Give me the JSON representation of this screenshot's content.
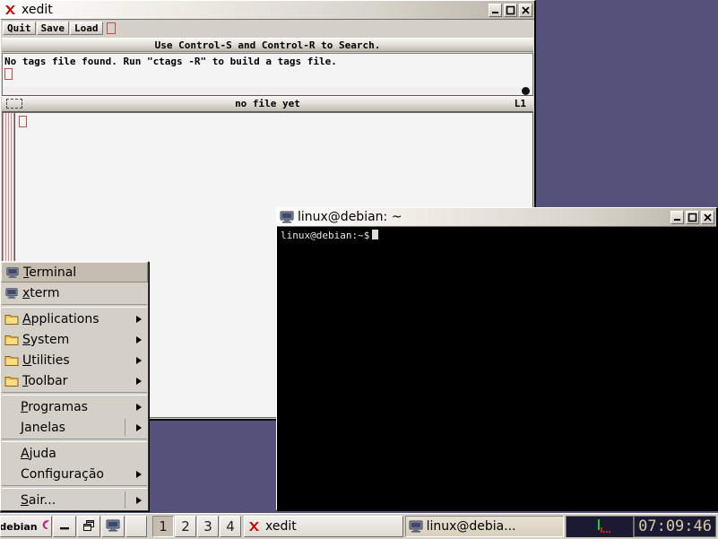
{
  "desktop": {
    "background_color": "#54527a"
  },
  "xedit": {
    "title": "xedit",
    "icon": "x-logo-icon",
    "buttons": {
      "quit": "Quit",
      "save": "Save",
      "load": "Load"
    },
    "message_bar": "Use Control-S and Control-R to Search.",
    "message_text": "No tags file found.  Run \"ctags -R\" to build a tags file.",
    "status_filename": "no file yet",
    "status_line": "L1",
    "window_controls": {
      "minimize": "minimize",
      "maximize": "maximize",
      "close": "close"
    }
  },
  "terminal": {
    "title": "linux@debian: ~",
    "icon": "computer-monitor-icon",
    "prompt": "linux@debian:~$",
    "window_controls": {
      "minimize": "minimize",
      "maximize": "maximize",
      "close": "close"
    }
  },
  "root_menu": {
    "items": [
      {
        "label": "Terminal",
        "mnemonic": "T",
        "icon": "computer-monitor-icon",
        "submenu": false,
        "selected": true,
        "indent": false
      },
      {
        "label": "xterm",
        "mnemonic": "x",
        "icon": "computer-monitor-icon",
        "submenu": false,
        "selected": false,
        "indent": false
      },
      {
        "sep": true
      },
      {
        "label": "Applications",
        "mnemonic": "A",
        "icon": "folder-icon",
        "submenu": true,
        "selected": false,
        "indent": false
      },
      {
        "label": "System",
        "mnemonic": "S",
        "icon": "folder-icon",
        "submenu": true,
        "selected": false,
        "indent": false
      },
      {
        "label": "Utilities",
        "mnemonic": "U",
        "icon": "folder-icon",
        "submenu": true,
        "selected": false,
        "indent": false
      },
      {
        "label": "Toolbar",
        "mnemonic": "T",
        "icon": "folder-icon",
        "submenu": true,
        "selected": false,
        "indent": false
      },
      {
        "sep": true
      },
      {
        "label": "Programas",
        "mnemonic": "P",
        "icon": null,
        "submenu": true,
        "selected": false,
        "indent": true
      },
      {
        "label": "Janelas",
        "mnemonic": "J",
        "icon": null,
        "submenu": true,
        "selected": false,
        "indent": true,
        "divider": true
      },
      {
        "sep": true
      },
      {
        "label": "Ajuda",
        "mnemonic": "A",
        "icon": null,
        "submenu": false,
        "selected": false,
        "indent": true
      },
      {
        "label": "Configuração",
        "mnemonic": "g",
        "icon": null,
        "submenu": true,
        "selected": false,
        "indent": true
      },
      {
        "sep": true
      },
      {
        "label": "Sair...",
        "mnemonic": "S",
        "icon": null,
        "submenu": true,
        "selected": false,
        "indent": true,
        "divider": true
      }
    ]
  },
  "taskbar": {
    "start_label": "debian",
    "start_icon": "debian-swirl-icon",
    "tool_buttons": [
      {
        "name": "show-desktop-button",
        "icon": "minimize-all-icon"
      },
      {
        "name": "window-list-button",
        "icon": "windows-cascade-icon"
      },
      {
        "name": "monitor-button",
        "icon": "computer-monitor-icon"
      },
      {
        "name": "blank-button",
        "icon": "blank-icon"
      }
    ],
    "workspaces": [
      {
        "label": "1",
        "active": true
      },
      {
        "label": "2",
        "active": false
      },
      {
        "label": "3",
        "active": false
      },
      {
        "label": "4",
        "active": false
      }
    ],
    "tasks": [
      {
        "label": "xedit",
        "icon": "x-logo-icon",
        "active": false
      },
      {
        "label": "linux@debia...",
        "icon": "computer-monitor-icon",
        "active": true
      }
    ],
    "tray": {
      "load_monitor": {
        "name": "cpu-load-monitor",
        "bg": "#1a1a33",
        "bar_colors": [
          "#22cc22",
          "#cc2222"
        ]
      },
      "clock": "07:09:46",
      "clock_bg": "#1a1a33",
      "clock_fg": "#d8c9a0"
    }
  }
}
